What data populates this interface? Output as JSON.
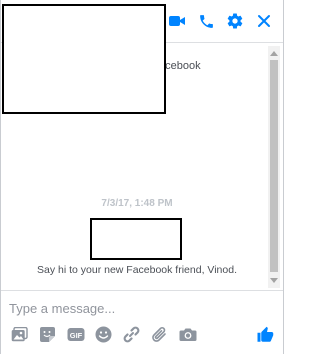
{
  "header": {
    "subtitle": "acebook",
    "icons": [
      "video-call-icon",
      "phone-icon",
      "gear-icon",
      "close-icon"
    ]
  },
  "conversation": {
    "timestamp": "7/3/17, 1:48 PM",
    "greeting": "Say hi to your new Facebook friend, Vinod."
  },
  "composer": {
    "placeholder": "Type a message...",
    "tools": [
      "photo-icon",
      "sticker-icon",
      "gif-icon",
      "emoji-icon",
      "link-icon",
      "attachment-icon",
      "camera-icon"
    ],
    "send_icon": "thumbs-up-icon"
  },
  "colors": {
    "accent": "#0084ff",
    "icon_gray": "#8d949e",
    "timestamp": "#bec3c9",
    "text": "#4b4f56"
  }
}
